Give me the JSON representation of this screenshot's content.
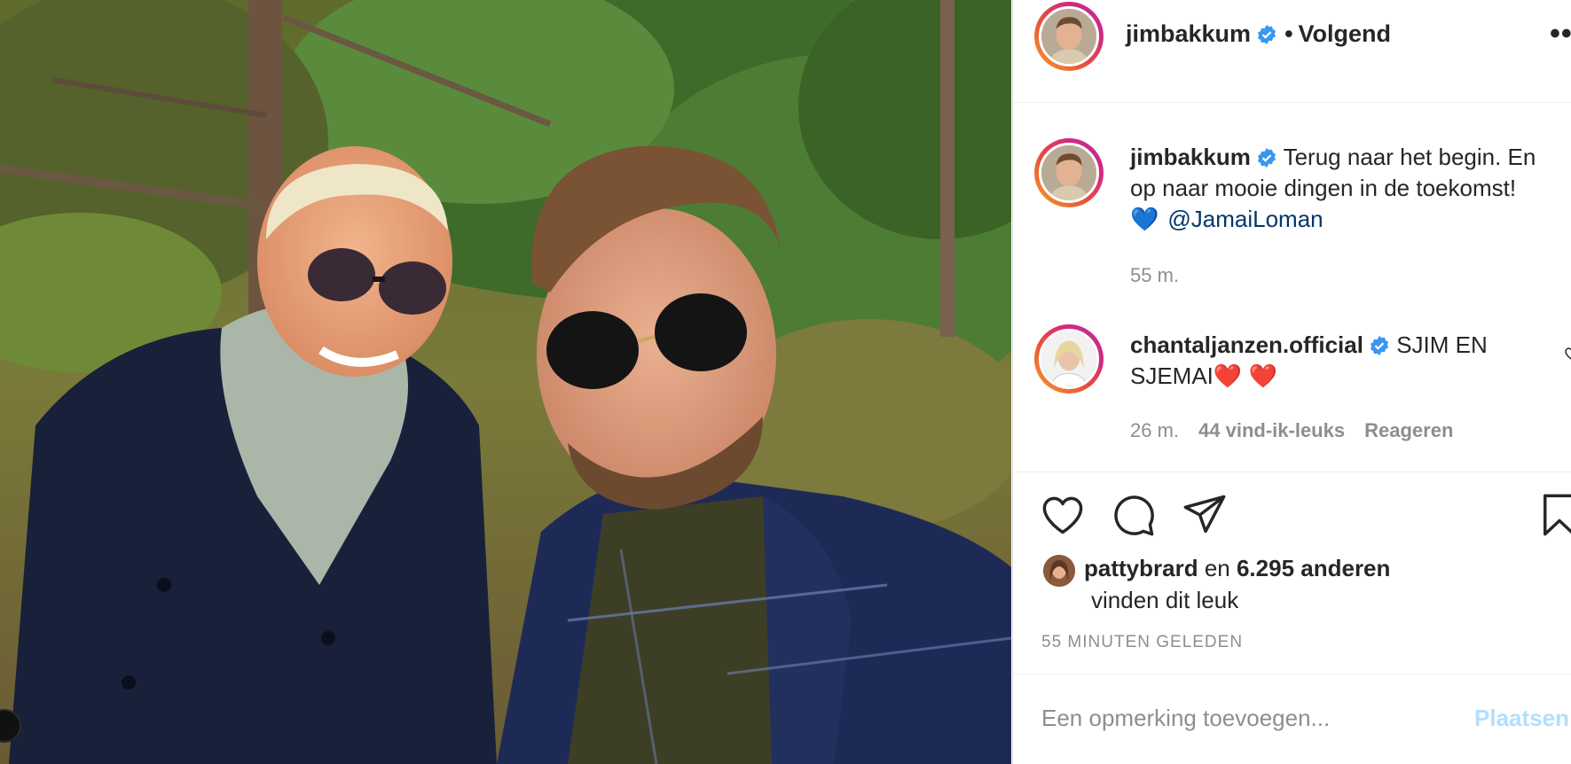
{
  "post": {
    "author": "jimbakkum",
    "follow_separator": "•",
    "follow_status": "Volgend",
    "more_options": "•••",
    "caption_line1": "Terug naar het begin. En",
    "caption_line2": "op naar mooie dingen in de toekomst!",
    "caption_emoji": "💙",
    "caption_mention": "@JamaiLoman",
    "caption_time": "55 m."
  },
  "comment": {
    "author": "chantaljanzen.official",
    "text_line1": "SJIM EN",
    "text_line2": "SJEMAI❤️ ❤️",
    "time": "26 m.",
    "likes": "44 vind-ik-leuks",
    "reply": "Reageren"
  },
  "likes": {
    "user": "pattybrard",
    "connector": "en",
    "others": "6.295 anderen",
    "suffix": "vinden dit leuk"
  },
  "timestamp": "55 MINUTEN GELEDEN",
  "add_comment": {
    "placeholder": "Een opmerking toevoegen...",
    "post_label": "Plaatsen"
  },
  "icons": {
    "verified": "verified-badge-icon",
    "like": "heart-icon",
    "comment": "comment-bubble-icon",
    "share": "paper-plane-icon",
    "save": "bookmark-icon"
  },
  "colors": {
    "verified_blue": "#3897f0",
    "mention_blue": "#00376b",
    "post_button_disabled": "#b2dffc",
    "secondary_text": "#8e8e8e"
  }
}
